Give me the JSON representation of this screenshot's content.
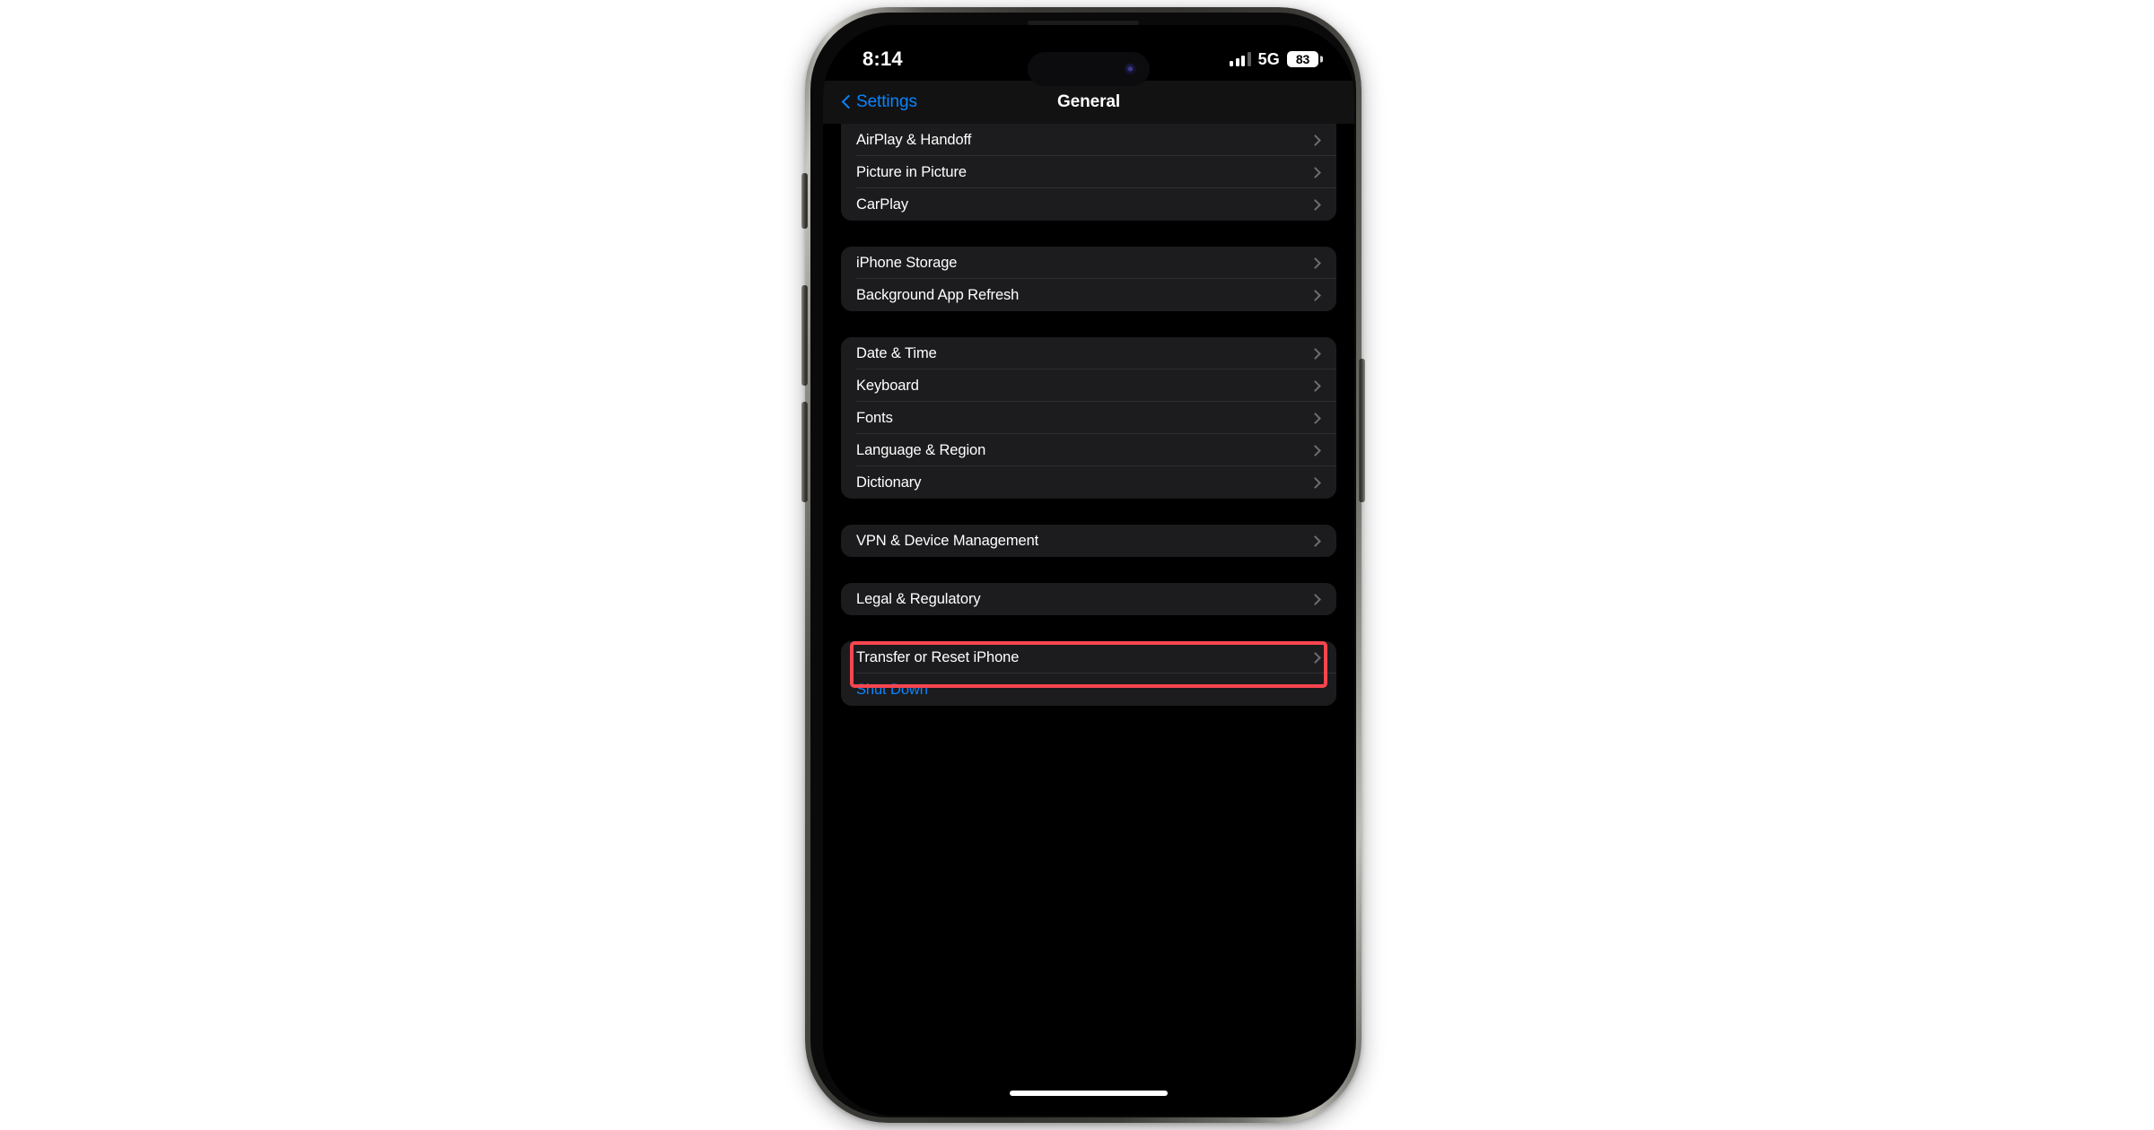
{
  "status_bar": {
    "time": "8:14",
    "signal_icon": "cellular-signal-icon",
    "signal_bars_filled": 3,
    "signal_bars_total": 4,
    "network_type": "5G",
    "battery_percent": "83"
  },
  "nav_bar": {
    "back_label": "Settings",
    "back_icon": "chevron-left-icon",
    "title": "General"
  },
  "colors": {
    "accent_blue": "#0a84ff",
    "highlight_red": "#f8454e",
    "card_background": "#1c1c1e",
    "screen_background": "#000000"
  },
  "groups": [
    {
      "id": "media-group",
      "clipped_top": true,
      "rows": [
        {
          "label": "AirPlay & Handoff",
          "accessory": "chevron-right-icon",
          "style": "default"
        },
        {
          "label": "Picture in Picture",
          "accessory": "chevron-right-icon",
          "style": "default"
        },
        {
          "label": "CarPlay",
          "accessory": "chevron-right-icon",
          "style": "default"
        }
      ]
    },
    {
      "id": "storage-group",
      "clipped_top": false,
      "rows": [
        {
          "label": "iPhone Storage",
          "accessory": "chevron-right-icon",
          "style": "default"
        },
        {
          "label": "Background App Refresh",
          "accessory": "chevron-right-icon",
          "style": "default"
        }
      ]
    },
    {
      "id": "localization-group",
      "clipped_top": false,
      "rows": [
        {
          "label": "Date & Time",
          "accessory": "chevron-right-icon",
          "style": "default"
        },
        {
          "label": "Keyboard",
          "accessory": "chevron-right-icon",
          "style": "default"
        },
        {
          "label": "Fonts",
          "accessory": "chevron-right-icon",
          "style": "default"
        },
        {
          "label": "Language & Region",
          "accessory": "chevron-right-icon",
          "style": "default"
        },
        {
          "label": "Dictionary",
          "accessory": "chevron-right-icon",
          "style": "default"
        }
      ]
    },
    {
      "id": "vpn-group",
      "clipped_top": false,
      "rows": [
        {
          "label": "VPN & Device Management",
          "accessory": "chevron-right-icon",
          "style": "default"
        }
      ]
    },
    {
      "id": "legal-group",
      "clipped_top": false,
      "rows": [
        {
          "label": "Legal & Regulatory",
          "accessory": "chevron-right-icon",
          "style": "default"
        }
      ]
    },
    {
      "id": "reset-group",
      "clipped_top": false,
      "highlighted": true,
      "rows": [
        {
          "label": "Transfer or Reset iPhone",
          "accessory": "chevron-right-icon",
          "style": "default"
        },
        {
          "label": "Shut Down",
          "accessory": "none",
          "style": "accent"
        }
      ]
    }
  ],
  "device": {
    "home_indicator": "home-indicator",
    "dynamic_island": "dynamic-island",
    "front_camera": "front-camera-icon",
    "buttons": [
      "action-button",
      "volume-up-button",
      "volume-down-button",
      "power-button"
    ]
  }
}
